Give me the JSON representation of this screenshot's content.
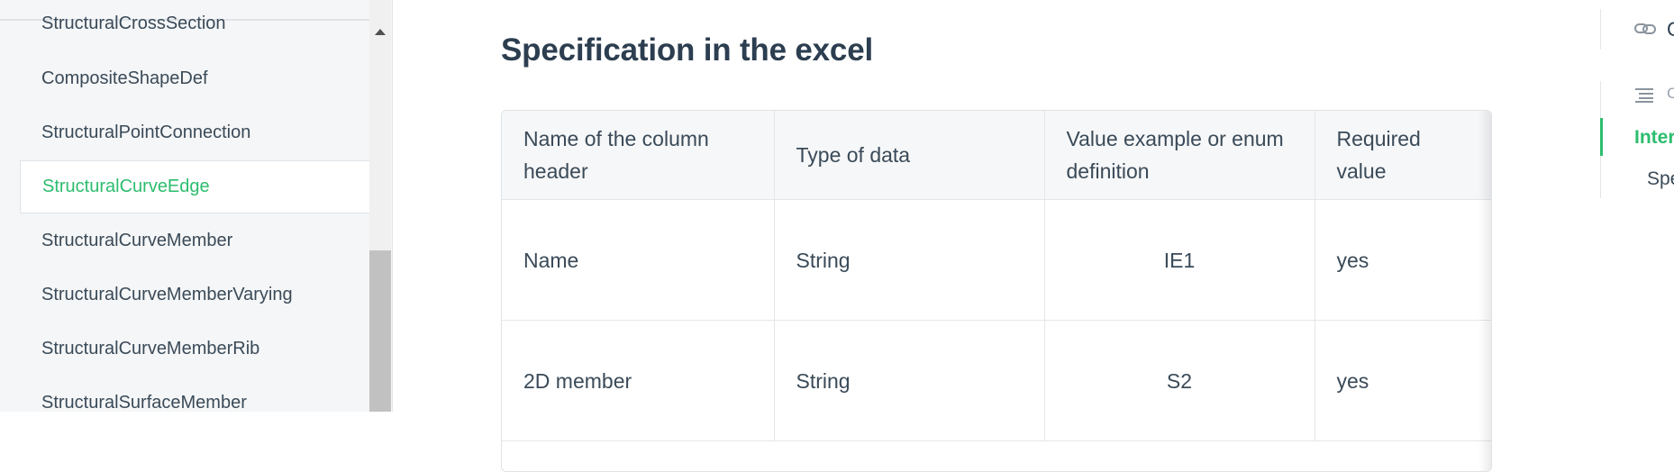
{
  "sidebar": {
    "items": [
      {
        "label": "StructuralCrossSection",
        "active": false
      },
      {
        "label": "CompositeShapeDef",
        "active": false
      },
      {
        "label": "StructuralPointConnection",
        "active": false
      },
      {
        "label": "StructuralCurveEdge",
        "active": true
      },
      {
        "label": "StructuralCurveMember",
        "active": false
      },
      {
        "label": "StructuralCurveMemberVarying",
        "active": false
      },
      {
        "label": "StructuralCurveMemberRib",
        "active": false
      },
      {
        "label": "StructuralSurfaceMember",
        "active": false
      }
    ]
  },
  "main": {
    "title": "Specification in the excel",
    "table": {
      "headers": [
        {
          "line1": "Name of the column",
          "line2": "header"
        },
        {
          "line1": "Type of data",
          "line2": ""
        },
        {
          "line1": "Value example or enum",
          "line2": "definition"
        },
        {
          "line1": "Required value",
          "line2": ""
        }
      ],
      "rows": [
        [
          "Name",
          "String",
          "IE1",
          "yes"
        ],
        [
          "2D member",
          "String",
          "S2",
          "yes"
        ]
      ]
    }
  },
  "toc": {
    "top_text": "C",
    "list_text": "C",
    "items": [
      "Inter",
      "Spe"
    ]
  },
  "colors": {
    "accent": "#2dbd6e",
    "text": "#2c3e50",
    "sidebar_bg": "#f5f6f7"
  }
}
